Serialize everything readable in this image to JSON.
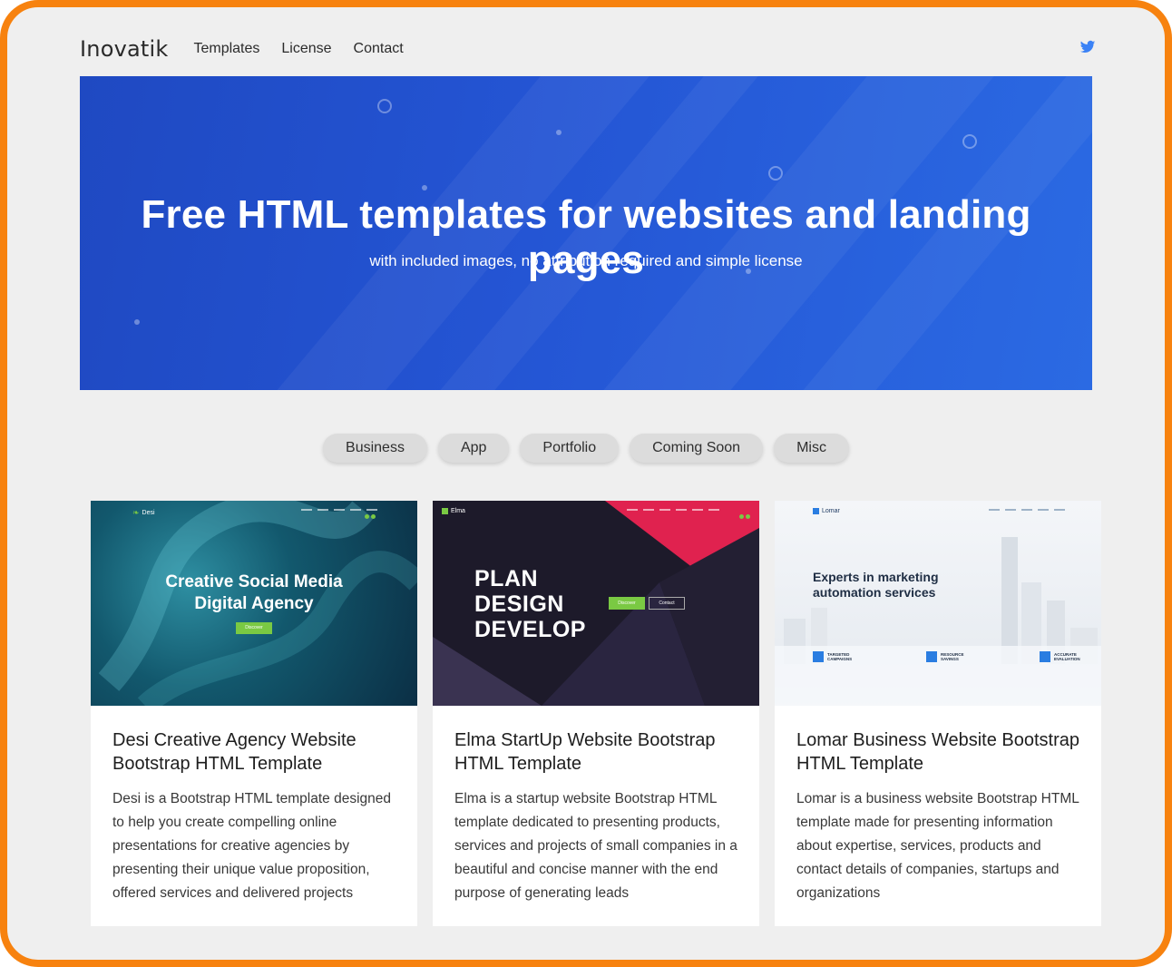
{
  "nav": {
    "brand": "Inovatik",
    "links": [
      "Templates",
      "License",
      "Contact"
    ],
    "twitter_icon": "twitter-icon",
    "twitter_color": "#3b82f6"
  },
  "hero": {
    "title": "Free HTML templates for websites and landing pages",
    "subtitle": "with included images, no attribution required and simple license",
    "bg_color": "#2455d4"
  },
  "filters": [
    "Business",
    "App",
    "Portfolio",
    "Coming Soon",
    "Misc"
  ],
  "cards": [
    {
      "thumb": {
        "logo": "Desi",
        "headline_1": "Creative Social Media",
        "headline_2": "Digital Agency",
        "cta": "Discover"
      },
      "title": "Desi Creative Agency Website Bootstrap HTML Template",
      "description": "Desi is a Bootstrap HTML template designed to help you create compelling online presentations for creative agencies by presenting their unique value proposition, offered services and delivered projects"
    },
    {
      "thumb": {
        "logo": "Elma",
        "line_1": "PLAN",
        "line_2": "DESIGN",
        "line_3": "DEVELOP",
        "btn_1": "Discover",
        "btn_2": "Contact"
      },
      "title": "Elma StartUp Website Bootstrap HTML Template",
      "description": "Elma is a startup website Bootstrap HTML template dedicated to presenting products, services and projects of small companies in a beautiful and concise manner with the end purpose of generating leads"
    },
    {
      "thumb": {
        "logo": "Lomar",
        "headline_1": "Experts in marketing",
        "headline_2": "automation services",
        "feature_1": "TARGETED CAMPAIGNS",
        "feature_2": "RESOURCE SAVINGS",
        "feature_3": "ACCURATE EVALUATION"
      },
      "title": "Lomar Business Website Bootstrap HTML Template",
      "description": "Lomar is a business website Bootstrap HTML template made for presenting information about expertise, services, products and contact details of companies, startups and organizations"
    }
  ],
  "colors": {
    "frame": "#f7820f",
    "page_bg": "#efefef",
    "accent_green": "#7ac943",
    "elma_red": "#e0224f"
  }
}
